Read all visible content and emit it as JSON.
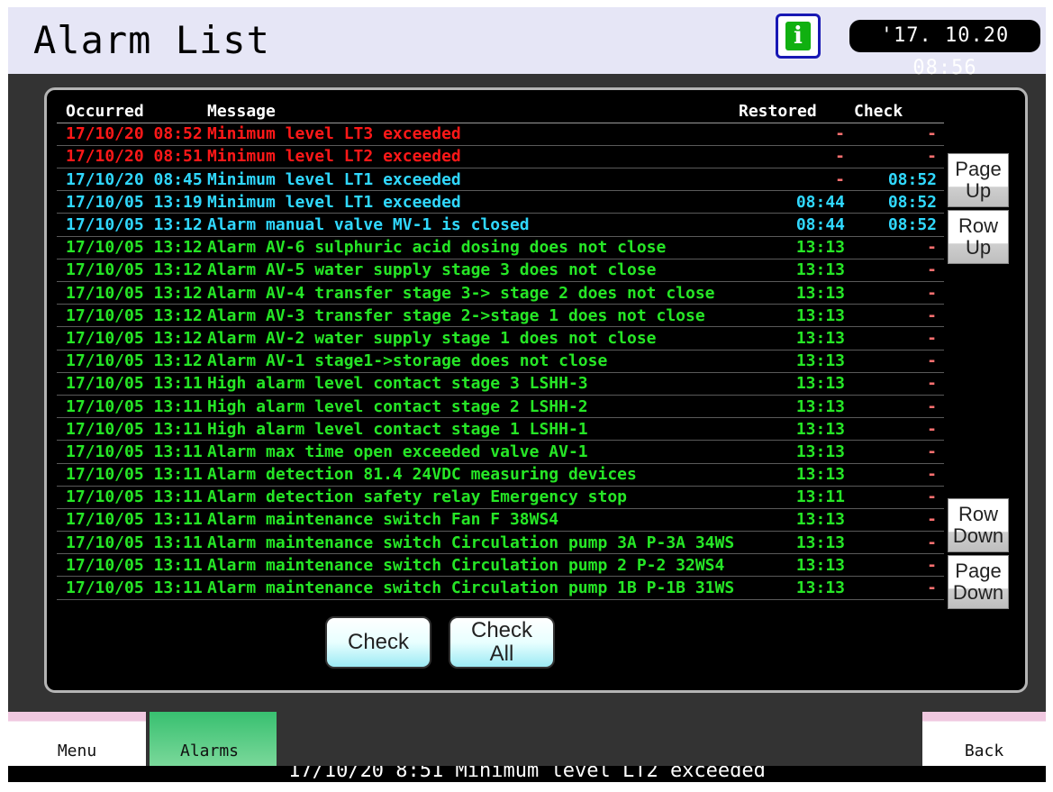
{
  "header": {
    "title": "Alarm List",
    "info_icon": "i",
    "clock": "'17. 10.20 08:56"
  },
  "table": {
    "columns": {
      "occurred": "Occurred",
      "message": "Message",
      "restored": "Restored",
      "check": "Check"
    },
    "rows": [
      {
        "occurred": "17/10/20 08:52",
        "message": "Minimum level LT3 exceeded",
        "restored": "-",
        "check": "-",
        "state": "red"
      },
      {
        "occurred": "17/10/20 08:51",
        "message": "Minimum level LT2 exceeded",
        "restored": "-",
        "check": "-",
        "state": "red"
      },
      {
        "occurred": "17/10/20 08:45",
        "message": "Minimum level LT1 exceeded",
        "restored": "-",
        "check": "08:52",
        "state": "cyan"
      },
      {
        "occurred": "17/10/05 13:19",
        "message": "Minimum level LT1 exceeded",
        "restored": "08:44",
        "check": "08:52",
        "state": "cyan"
      },
      {
        "occurred": "17/10/05 13:12",
        "message": "Alarm manual valve MV-1 is closed",
        "restored": "08:44",
        "check": "08:52",
        "state": "cyan"
      },
      {
        "occurred": "17/10/05 13:12",
        "message": "Alarm AV-6 sulphuric acid dosing does not close",
        "restored": "13:13",
        "check": "-",
        "state": "green"
      },
      {
        "occurred": "17/10/05 13:12",
        "message": "Alarm AV-5 water supply stage 3 does not close",
        "restored": "13:13",
        "check": "-",
        "state": "green"
      },
      {
        "occurred": "17/10/05 13:12",
        "message": "Alarm AV-4 transfer stage 3-> stage 2 does not close",
        "restored": "13:13",
        "check": "-",
        "state": "green"
      },
      {
        "occurred": "17/10/05 13:12",
        "message": "Alarm AV-3 transfer stage 2->stage 1 does not close",
        "restored": "13:13",
        "check": "-",
        "state": "green"
      },
      {
        "occurred": "17/10/05 13:12",
        "message": "Alarm AV-2 water supply stage 1 does not close",
        "restored": "13:13",
        "check": "-",
        "state": "green"
      },
      {
        "occurred": "17/10/05 13:12",
        "message": "Alarm AV-1 stage1->storage does not close",
        "restored": "13:13",
        "check": "-",
        "state": "green"
      },
      {
        "occurred": "17/10/05 13:11",
        "message": "High alarm level contact stage 3  LSHH-3",
        "restored": "13:13",
        "check": "-",
        "state": "green"
      },
      {
        "occurred": "17/10/05 13:11",
        "message": "High alarm level contact stage 2  LSHH-2",
        "restored": "13:13",
        "check": "-",
        "state": "green"
      },
      {
        "occurred": "17/10/05 13:11",
        "message": "High alarm level contact stage 1  LSHH-1",
        "restored": "13:13",
        "check": "-",
        "state": "green"
      },
      {
        "occurred": "17/10/05 13:11",
        "message": "Alarm max time open exceeded valve  AV-1",
        "restored": "13:13",
        "check": "-",
        "state": "green"
      },
      {
        "occurred": "17/10/05 13:11",
        "message": "Alarm detection 81.4 24VDC  measuring devices",
        "restored": "13:13",
        "check": "-",
        "state": "green"
      },
      {
        "occurred": "17/10/05 13:11",
        "message": "Alarm detection safety relay Emergency stop",
        "restored": "13:11",
        "check": "-",
        "state": "green"
      },
      {
        "occurred": "17/10/05 13:11",
        "message": "Alarm maintenance switch Fan F 38WS4",
        "restored": "13:13",
        "check": "-",
        "state": "green"
      },
      {
        "occurred": "17/10/05 13:11",
        "message": "Alarm maintenance switch Circulation pump 3A P-3A 34WS",
        "restored": "13:13",
        "check": "-",
        "state": "green"
      },
      {
        "occurred": "17/10/05 13:11",
        "message": "Alarm maintenance switch Circulation pump 2 P-2 32WS4",
        "restored": "13:13",
        "check": "-",
        "state": "green"
      },
      {
        "occurred": "17/10/05 13:11",
        "message": "Alarm maintenance switch Circulation pump 1B P-1B 31WS",
        "restored": "13:13",
        "check": "-",
        "state": "green"
      }
    ]
  },
  "side_buttons": {
    "page_up": [
      "Page",
      "Up"
    ],
    "row_up": [
      "Row",
      "Up"
    ],
    "row_down": [
      "Row",
      "Down"
    ],
    "page_down": [
      "Page",
      "Down"
    ]
  },
  "actions": {
    "check": "Check",
    "check_all": [
      "Check",
      "All"
    ]
  },
  "nav": {
    "menu": "Menu",
    "alarms": "Alarms",
    "back": "Back"
  },
  "status_bar": "17/10/20  8:51 Minimum level LT2 exceeded",
  "colors": {
    "red": "#ff1818",
    "cyan": "#30d8ff",
    "green": "#26e626",
    "header_bg": "#e6e6f6",
    "active_tab": "#38c070"
  }
}
